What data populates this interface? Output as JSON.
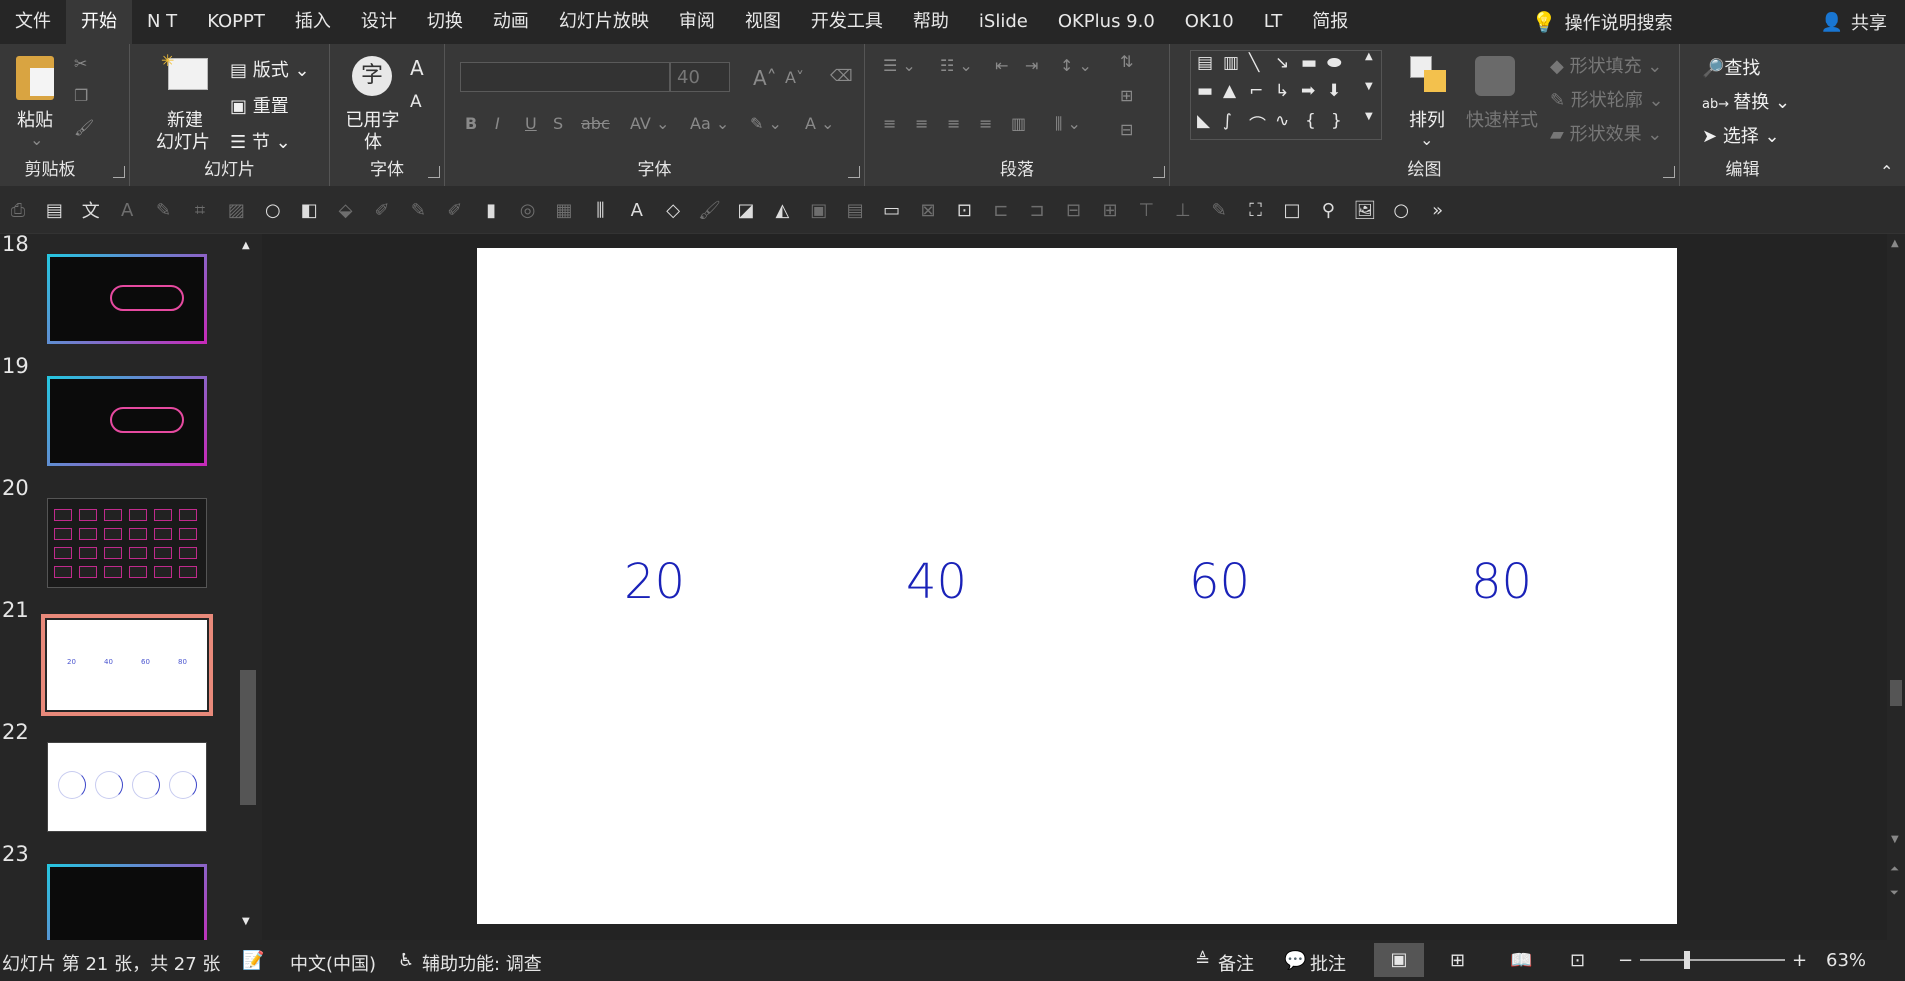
{
  "menu": {
    "tabs": [
      "文件",
      "开始",
      "N T",
      "KOPPT",
      "插入",
      "设计",
      "切换",
      "动画",
      "幻灯片放映",
      "审阅",
      "视图",
      "开发工具",
      "帮助",
      "iSlide",
      "OKPlus 9.0",
      "OK10",
      "LT",
      "简报"
    ],
    "active_index": 1,
    "search_label": "操作说明搜索",
    "share_label": "共享"
  },
  "ribbon": {
    "clipboard": {
      "paste": "粘贴",
      "group": "剪贴板"
    },
    "slides": {
      "new_slide_line1": "新建",
      "new_slide_line2": "幻灯片",
      "layout": "版式",
      "reset": "重置",
      "section": "节",
      "group": "幻灯片"
    },
    "used_font": {
      "line1": "已用字",
      "line2": "体",
      "group": "字体"
    },
    "font": {
      "size": "40",
      "group": "字体"
    },
    "paragraph": {
      "group": "段落"
    },
    "drawing": {
      "arrange": "排列",
      "quick_styles": "快速样式",
      "shape_fill": "形状填充",
      "shape_outline": "形状轮廓",
      "shape_effect": "形状效果",
      "group": "绘图"
    },
    "editing": {
      "find": "查找",
      "replace": "替换",
      "select": "选择",
      "group": "编辑"
    }
  },
  "thumbnails": [
    {
      "number": "18",
      "style": "dark-gradient"
    },
    {
      "number": "19",
      "style": "dark-gradient"
    },
    {
      "number": "20",
      "style": "dark-grid"
    },
    {
      "number": "21",
      "style": "white-selected"
    },
    {
      "number": "22",
      "style": "white-circles"
    },
    {
      "number": "23",
      "style": "dark-gradient"
    }
  ],
  "slide": {
    "values": [
      "20",
      "40",
      "60",
      "80"
    ],
    "text_color": "#1a22b8"
  },
  "status": {
    "slide_info": "幻灯片 第 21 张，共 27 张",
    "language": "中文(中国)",
    "accessibility": "辅助功能: 调查",
    "notes": "备注",
    "comments": "批注",
    "zoom": "63%"
  },
  "colors": {
    "accent_selected": "#e8897a",
    "menubar": "#262626",
    "ribbon": "#383838"
  }
}
